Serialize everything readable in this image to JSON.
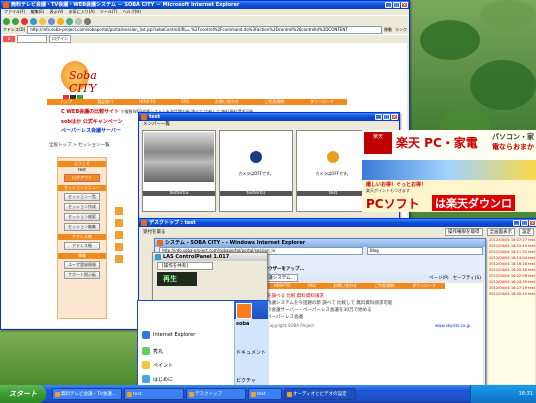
{
  "main_window": {
    "title": "無料テレビ会議・TV会議・WEB会議システム － SOBA CITY － Microsoft Internet Explorer",
    "menu": [
      "ファイル(F)",
      "編集(E)",
      "表示(V)",
      "お気に入り(A)",
      "ツール(T)",
      "ヘルプ(H)"
    ],
    "address_label": "アドレス(D)",
    "address": "http://info.soba-project.com/sobaportal/portal/session_list.jsp?sobaControlURL=.%2Fcontrol%2Fcommand.do%3Faction%3Dcontrol%26controlId%3DCONTENT",
    "go_label": "移動",
    "links_label": "リンク",
    "login_label": "ログイン"
  },
  "soba_page": {
    "logo": "Soba CITY",
    "nav": [
      "トップ",
      "製品紹介",
      "HOW-TO",
      "FAQ",
      "お問い合わせ",
      "ご利用規約",
      "ダウンロード"
    ],
    "headline1": "C WEB会議の比較サイト",
    "headline1_rest": "で複数WEB会議システムを今話題の新 調べて 比較して 無料資料請求可能",
    "headline2": "sobはか 公式キャンペーン",
    "headline3": "ペーパーレス会議サーバー",
    "breadcrumb": "全般トップ > セッション一覧",
    "side": {
      "welcome": "ようこそ",
      "user": "test",
      "logout": "ログアウト",
      "menu_title": "セッションメニュー",
      "buttons": [
        "セッション一覧",
        "セッション作成",
        "セッション検索",
        "セッション編集"
      ],
      "address_title": "アドレス帳",
      "address_buttons": [
        "アドレス帳"
      ],
      "help_title": "情報",
      "help_buttons": [
        "ユーザ登録情報",
        "サポート掲示板"
      ]
    }
  },
  "video_window": {
    "title": "test",
    "member_tab": "メンバー一覧",
    "tiles": [
      {
        "name": "tester03",
        "caption": "",
        "type": "photo"
      },
      {
        "name": "tester01",
        "caption": "カメラはOFFです。",
        "type": "avatar"
      },
      {
        "name": "test",
        "caption": "カメラはOFFです。",
        "type": "avatar"
      }
    ]
  },
  "ads": {
    "rakuten_pc": "楽天 PC・家電",
    "pc_right": "パソコン・家",
    "pc_right2": "電ならおまか",
    "sale_line": "嬉しいお得！ぐっとお得！",
    "sale_detail": "楽天ポイントもつきます",
    "pcsoft": "PCソフト",
    "pcsoft_right": "は楽天ダウンロ",
    "small": "楽天"
  },
  "desktop_window": {
    "title": "デスクトップ : test",
    "button1": "操作権限を取得",
    "button2": "全画面表示",
    "button3": "設定",
    "tab_label": "受付を取る"
  },
  "las_panel": {
    "title": "LAS ControlPanel 1.017",
    "action": "[操作を共有]",
    "play_label": "再生"
  },
  "ie2_window": {
    "title": "システム - SOBA CITY - - Windows Internet Explorer",
    "address": "http://info.soba-project.com/sobaportal/portal/session_in",
    "search": "Blog",
    "fav_label": "お気に入り",
    "fav_add": "おすすめサイト",
    "browser_app": "ブラウザーをアップ...",
    "tab_label": "無料テレビ会議・TV会議・WEB会議システム...",
    "tools": [
      "ページ(P)",
      "セーフティ(S)"
    ],
    "tray_items": [
      "ドキュ",
      "Fast text",
      "エスポー",
      "ビジネス",
      "販売"
    ],
    "page_nav": [
      "HOW-TO",
      "FAQ",
      "お問い合わせ",
      "ご利用規約",
      "ダウンロード"
    ],
    "page_text1": "を調べる 比較 無料資料請求",
    "page_text2": "会議システムを今話題の新 調べて 比較して 無料資料請求可能",
    "page_text3": "の会議サーバー - ペーパーレス会議を30万で始める",
    "page_text4": "ペーパーレス会議",
    "footer": "Copyright SOBA Project",
    "footer_link": "www.skysite.co.jp"
  },
  "log_panel": {
    "entries": [
      "2012/04/04 16:07:27 tester",
      "2012/04/04 16:10:44 tester",
      "2012/04/04 16:11:32 tester",
      "2012/04/04 16:14:04 tester",
      "2012/04/04 16:16:28 tester",
      "2012/04/04 16:20:30 tester",
      "2012/04/04 16:22:08 tester",
      "2012/04/04 16:24:39 tester",
      "2012/04/04 16:27:19 tester",
      "2012/04/04 16:30:10 tester"
    ]
  },
  "start_menu": {
    "left": [
      "Internet Explorer",
      "秀丸",
      "ペイント",
      "はじめに"
    ],
    "right": [
      "soba",
      "ドキュメント",
      "ピクチャ"
    ]
  },
  "taskbar": {
    "start": "スタート",
    "tasks": [
      "無料テレビ会議・TV会議...",
      "test",
      "デスクトップ",
      "test",
      "オーディオとビデオの設定"
    ],
    "active_index": 4,
    "clock": "16:31"
  }
}
